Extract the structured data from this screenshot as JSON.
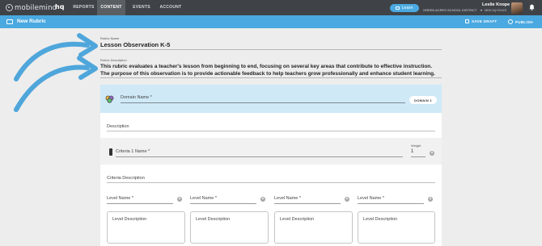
{
  "topnav": {
    "logo_text": "mobilemind",
    "hq": "hq",
    "items": [
      "REPORTS",
      "CONTENT",
      "EVENTS",
      "ACCOUNT"
    ],
    "active": "CONTENT",
    "learn_label": "Learn",
    "user_name": "Leslie Knope",
    "district": "GREEN ACRES SCHOOL DISTRICT",
    "role": "NEW HQ ROLES"
  },
  "subheader": {
    "title": "New Rubric",
    "save_draft": "SAVE DRAFT",
    "publish": "PUBLISH"
  },
  "rubric": {
    "name_label": "Rubric Name",
    "name_value": "Lesson Observation K-5",
    "desc_label": "Rubric Description",
    "desc_value": "This rubric evaluates a teacher's lesson from beginning to end, focusing on several key areas that contribute to effective instruction. The purpose of this observation is to provide actionable feedback to help teachers grow professionally and enhance student learning."
  },
  "domain": {
    "name_placeholder": "Domain Name *",
    "badge": "DOMAIN 1",
    "description_placeholder": "Description"
  },
  "criteria": {
    "name_placeholder": "Criteria 1 Name *",
    "weight_label": "Weight",
    "weight_value": "1",
    "description_placeholder": "Criteria Description"
  },
  "levels": [
    {
      "name_placeholder": "Level Name *",
      "description_placeholder": "Level Description"
    },
    {
      "name_placeholder": "Level Name *",
      "description_placeholder": "Level Description"
    },
    {
      "name_placeholder": "Level Name *",
      "description_placeholder": "Level Description"
    },
    {
      "name_placeholder": "Level Name *",
      "description_placeholder": "Level Description"
    }
  ],
  "colors": {
    "nav": "#3f4347",
    "accent": "#4aa9e0",
    "domain_bar": "#cfe9f7"
  },
  "icons": [
    "bell-icon",
    "learn-icon",
    "rubric-icon",
    "save-icon",
    "globe-icon",
    "domain-icon",
    "drag-handle-icon",
    "close-icon"
  ]
}
